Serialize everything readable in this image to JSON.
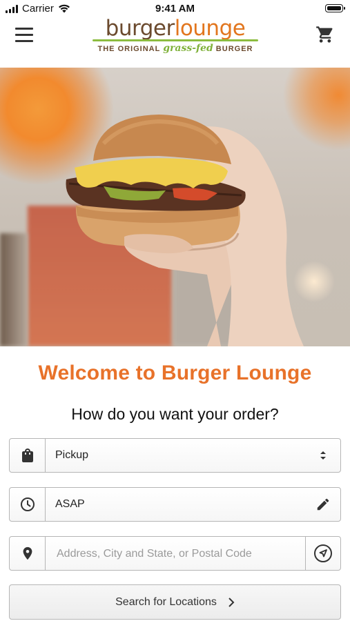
{
  "status_bar": {
    "carrier": "Carrier",
    "time": "9:41 AM"
  },
  "header": {
    "logo_word1": "burger",
    "logo_word2": "lounge",
    "tagline_pre": "THE ORIGINAL ",
    "tagline_em": "grass-fed",
    "tagline_post": " BURGER",
    "menu_icon": "hamburger-menu-icon",
    "cart_icon": "shopping-cart-icon"
  },
  "hero": {
    "image": "burger-in-hand-photo"
  },
  "main": {
    "welcome": "Welcome to Burger Lounge",
    "question": "How do you want your order?",
    "order_type": {
      "value": "Pickup",
      "icon": "shopping-bag-icon",
      "right_icon": "updown-chevron-icon"
    },
    "time": {
      "value": "ASAP",
      "icon": "clock-icon",
      "right_icon": "pencil-icon"
    },
    "address": {
      "placeholder": "Address, City and State, or Postal Code",
      "icon": "location-pin-icon",
      "right_icon": "navigation-arrow-icon"
    },
    "search_label": "Search for Locations"
  },
  "colors": {
    "accent": "#e8722a",
    "brand_brown": "#6b4a2e",
    "brand_green": "#8cbc3f"
  }
}
